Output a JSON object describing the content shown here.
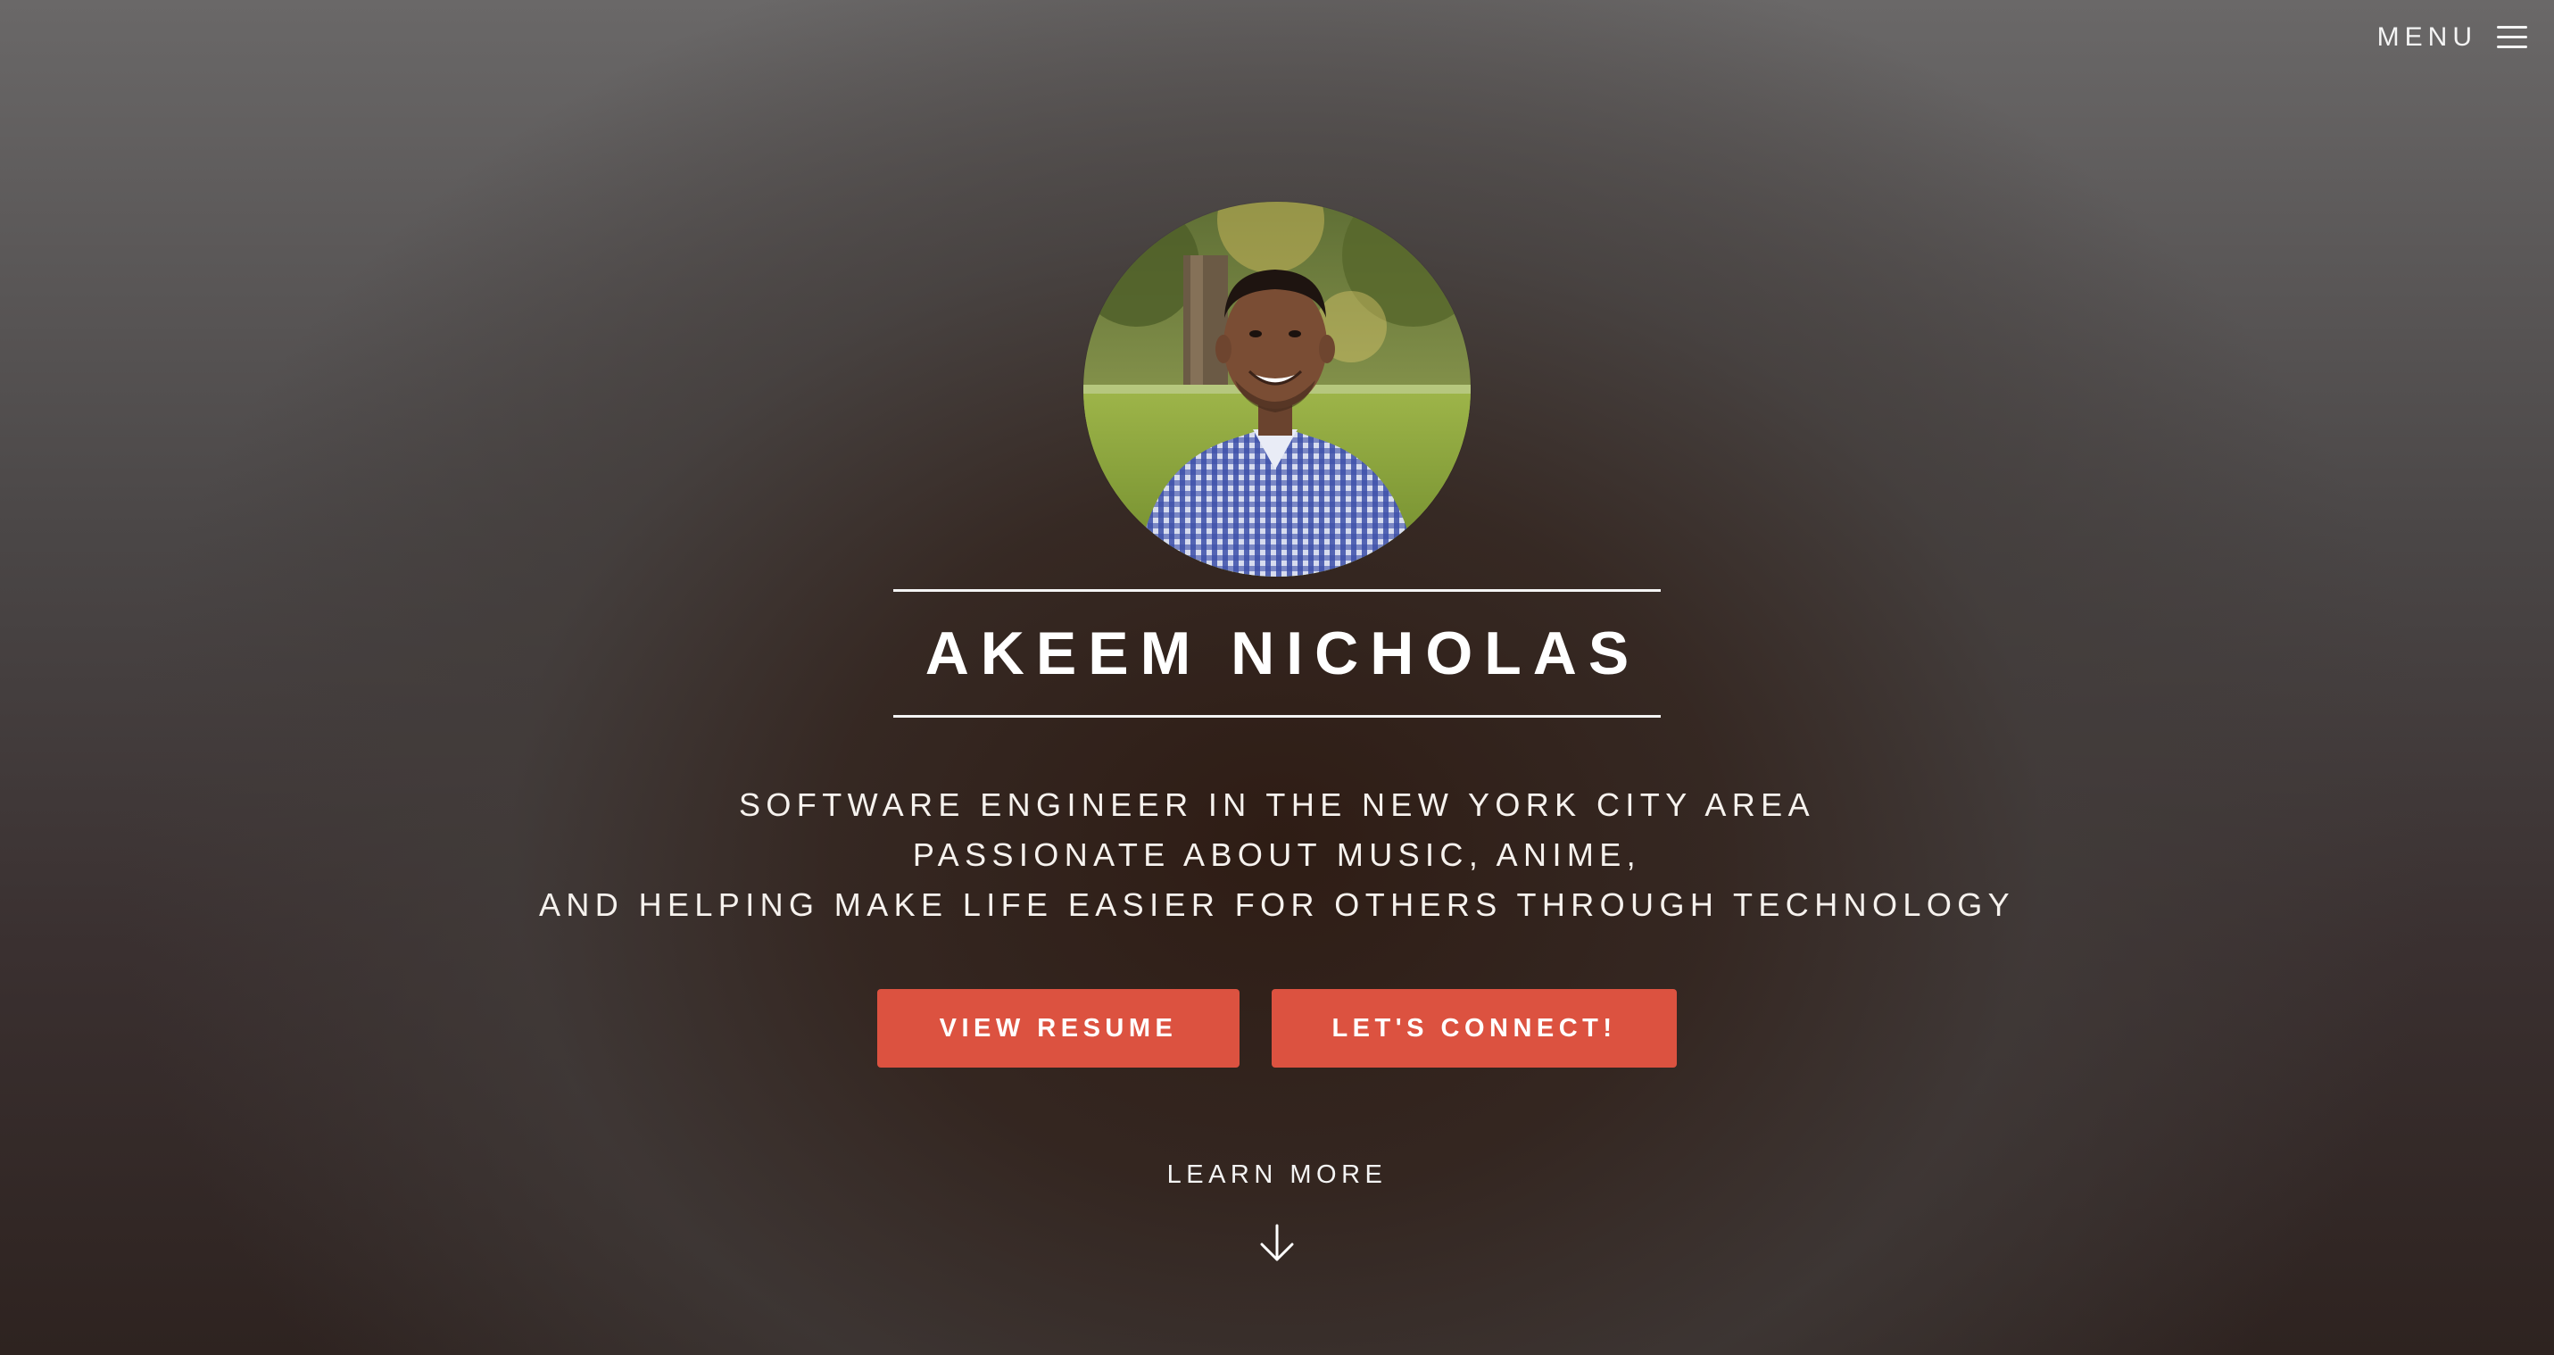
{
  "header": {
    "menu_label": "MENU",
    "menu_icon": "hamburger-icon"
  },
  "hero": {
    "profile_photo": "profile-photo",
    "name": "AKEEM NICHOLAS",
    "tagline_lines": [
      "SOFTWARE ENGINEER IN THE NEW YORK CITY AREA",
      "PASSIONATE ABOUT MUSIC, ANIME,",
      "AND HELPING MAKE LIFE EASIER FOR OTHERS THROUGH TECHNOLOGY"
    ],
    "buttons": {
      "resume_label": "VIEW RESUME",
      "connect_label": "LET'S CONNECT!"
    },
    "learn_more": {
      "label": "LEARN MORE",
      "icon": "arrow-down-icon"
    }
  },
  "colors": {
    "accent": "#dc5240",
    "text": "#ffffff"
  }
}
